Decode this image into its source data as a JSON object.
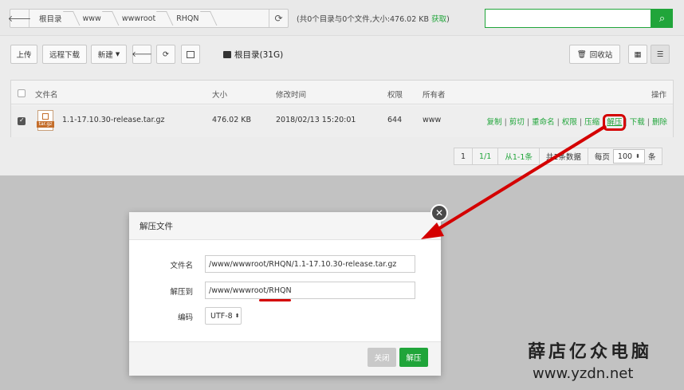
{
  "pathbar": {
    "crumbs": [
      "根目录",
      "www",
      "wwwroot",
      "RHQN"
    ],
    "info": "(共0个目录与0个文件,大小:476.02 KB",
    "get_link": "获取",
    "info_end": ")",
    "search_placeholder": ""
  },
  "toolbar": {
    "upload": "上传",
    "remote_download": "远程下载",
    "new": "新建",
    "root_label": "根目录(31G)",
    "recycle": "回收站"
  },
  "table": {
    "headers": {
      "name": "文件名",
      "size": "大小",
      "mtime": "修改时间",
      "perm": "权限",
      "owner": "所有者",
      "ops": "操作"
    },
    "rows": [
      {
        "name": "1.1-17.10.30-release.tar.gz",
        "size": "476.02 KB",
        "mtime": "2018/02/13 15:20:01",
        "perm": "644",
        "owner": "www",
        "icon_tag": "tar.gz",
        "checked": true
      }
    ],
    "ops": [
      "复制",
      "剪切",
      "重命名",
      "权限",
      "压缩",
      "解压",
      "下载",
      "删除"
    ],
    "ops_separator": "|"
  },
  "pager": {
    "first": "1",
    "pages": "1/1",
    "range": "从1-1条",
    "total": "共1条数据",
    "per_page_label": "每页",
    "per_page_value": "100",
    "per_page_unit": "条"
  },
  "dialog": {
    "title": "解压文件",
    "filename_label": "文件名",
    "filename_value": "/www/wwwroot/RHQN/1.1-17.10.30-release.tar.gz",
    "dest_label": "解压到",
    "dest_value": "/www/wwwroot/RHQN",
    "encoding_label": "编码",
    "encoding_value": "UTF-8",
    "close_button": "关闭",
    "extract_button": "解压"
  },
  "watermark": {
    "name": "薛店亿众电脑",
    "url": "www.yzdn.net"
  },
  "colors": {
    "accent": "#20a53a",
    "highlight": "#d40000",
    "close_btn": "#c9c9c9"
  }
}
